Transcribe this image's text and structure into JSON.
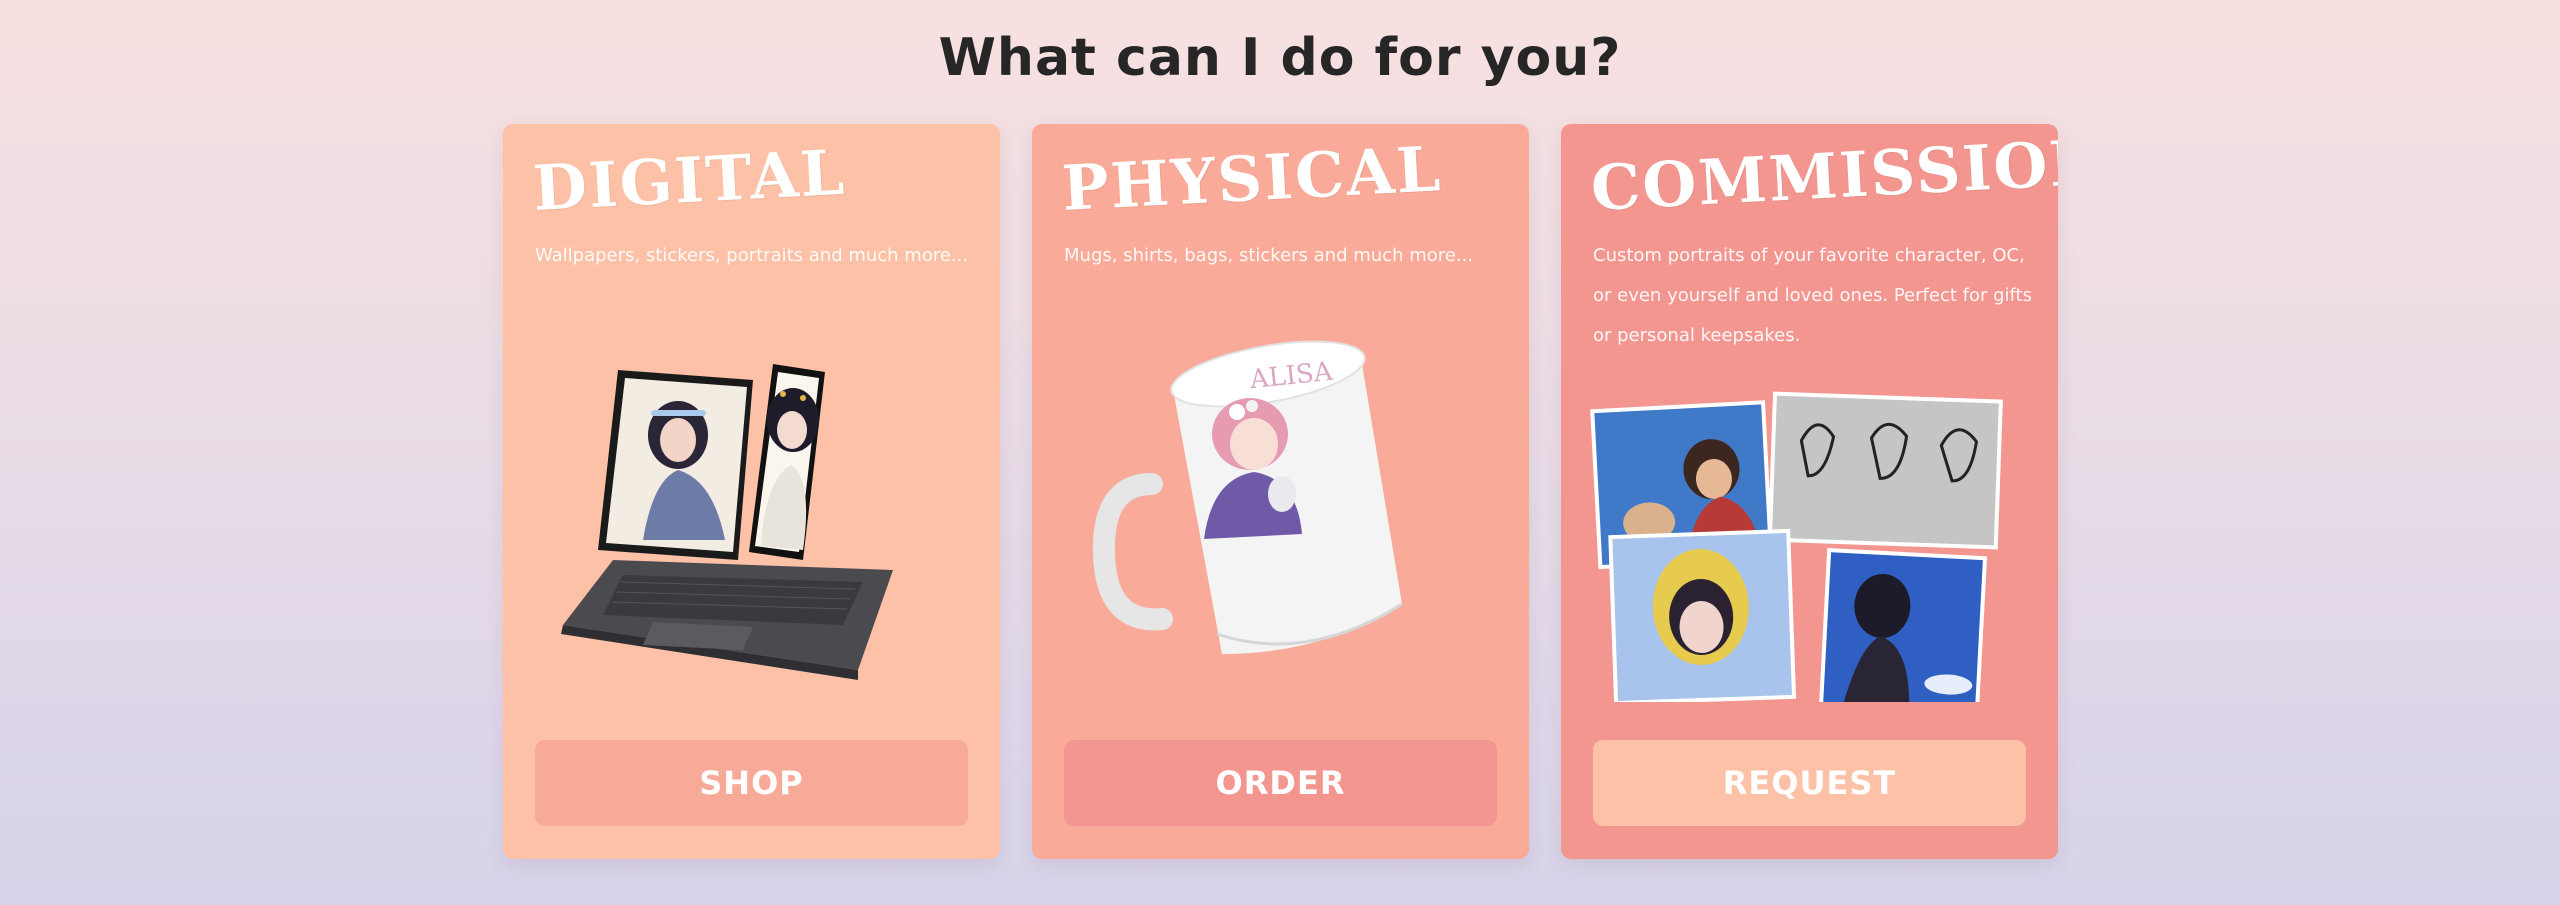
{
  "page": {
    "heading": "What can I do for you?"
  },
  "cards": [
    {
      "title": "DIGITAL",
      "description": "Wallpapers, stickers, portraits and much more...",
      "button_label": "SHOP",
      "art": "laptop-and-phone-illustration"
    },
    {
      "title": "PHYSICAL",
      "description": "Mugs, shirts, bags, stickers and much more...",
      "button_label": "ORDER",
      "art": "mug-illustration",
      "mug_text": "ALISA"
    },
    {
      "title": "COMMISSIONS",
      "description": "Custom portraits of your favorite character, OC, or even yourself and loved ones. Perfect for gifts or personal keepsakes.",
      "button_label": "REQUEST",
      "art": "portrait-collage"
    }
  ],
  "colors": {
    "digital_card": "#fcc1a6",
    "physical_card": "#f9aa98",
    "commissions_card": "#f39690",
    "heading_text": "#262626"
  }
}
